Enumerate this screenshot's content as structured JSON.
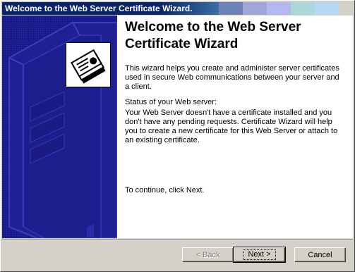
{
  "window": {
    "title": "Welcome to the Web Server Certificate Wizard."
  },
  "titlebar": {
    "decor_colors": [
      "#6d83b8",
      "#a1a6d8",
      "#b4b8f0",
      "#a9d8d8",
      "#b4d8f4",
      "#d4d0c8"
    ]
  },
  "side_panel": {
    "background": "#1a1b8a",
    "logo_icon": "certificate-stack-icon"
  },
  "main": {
    "heading": "Welcome to the Web Server Certificate Wizard",
    "intro": "This wizard helps you create and administer server certificates used in secure Web communications between your server and a client.",
    "status_label": "Status of your Web server:",
    "status_text": "Your Web Server doesn't have a certificate installed and you don't have any pending requests. Certificate Wizard will help you to create a new certificate for this Web Server or attach to an existing certificate.",
    "continue_text": "To continue, click Next."
  },
  "buttons": {
    "back": "< Back",
    "next": "Next >",
    "cancel": "Cancel"
  }
}
